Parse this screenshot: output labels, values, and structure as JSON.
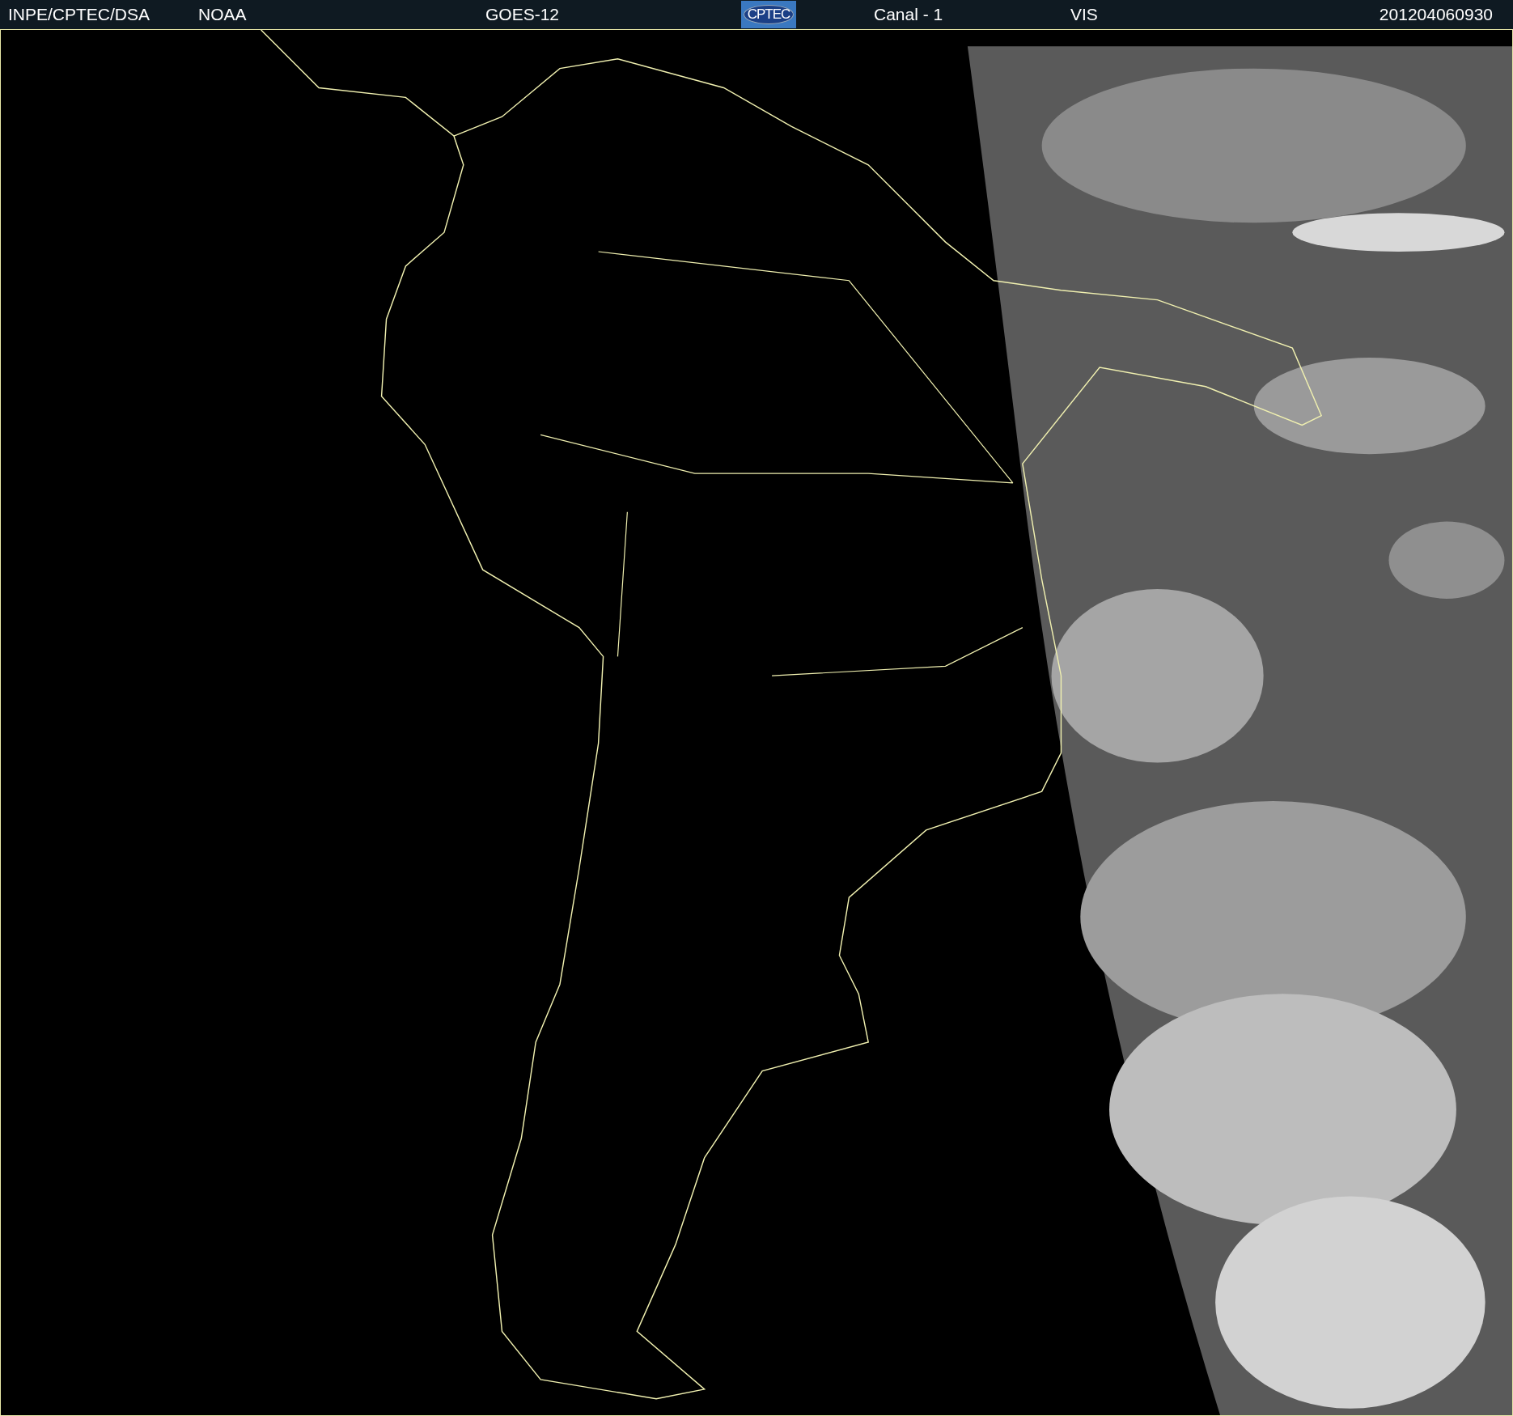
{
  "header": {
    "institution": "INPE/CPTEC/DSA",
    "agency": "NOAA",
    "satellite": "GOES-12",
    "logo": "CPTEC",
    "channel": "Canal - 1",
    "band": "VIS",
    "timestamp": "201204060930"
  }
}
